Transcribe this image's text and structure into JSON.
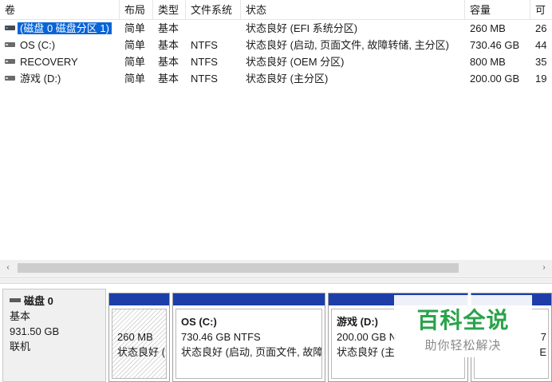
{
  "columns": [
    "卷",
    "布局",
    "类型",
    "文件系统",
    "状态",
    "容量",
    "可"
  ],
  "volumes": [
    {
      "icon": "efi-volume-icon",
      "name": "(磁盘 0 磁盘分区 1)",
      "layout": "简单",
      "type": "基本",
      "fs": "",
      "status": "状态良好 (EFI 系统分区)",
      "capacity": "260 MB",
      "free": "26",
      "selected": true
    },
    {
      "icon": "volume-icon",
      "name": "OS (C:)",
      "layout": "简单",
      "type": "基本",
      "fs": "NTFS",
      "status": "状态良好 (启动, 页面文件, 故障转储, 主分区)",
      "capacity": "730.46 GB",
      "free": "44",
      "selected": false
    },
    {
      "icon": "volume-icon",
      "name": "RECOVERY",
      "layout": "简单",
      "type": "基本",
      "fs": "NTFS",
      "status": "状态良好 (OEM 分区)",
      "capacity": "800 MB",
      "free": "35",
      "selected": false
    },
    {
      "icon": "volume-icon",
      "name": "游戏 (D:)",
      "layout": "简单",
      "type": "基本",
      "fs": "NTFS",
      "status": "状态良好 (主分区)",
      "capacity": "200.00 GB",
      "free": "19",
      "selected": false
    }
  ],
  "scrollbar": {
    "left_arrow": "‹",
    "right_arrow": "›"
  },
  "disk": {
    "title": "磁盘 0",
    "type": "基本",
    "size": "931.50 GB",
    "state": "联机"
  },
  "partitions": [
    {
      "name": "",
      "size": "260 MB",
      "status": "状态良好 (",
      "hatched": true
    },
    {
      "name": "OS  (C:)",
      "size": "730.46 GB NTFS",
      "status": "状态良好 (启动, 页面文件, 故障",
      "hatched": false
    },
    {
      "name": "游戏  (D:)",
      "size": "200.00 GB N",
      "status": "状态良好 (主",
      "hatched": false
    },
    {
      "name": "",
      "size": "7",
      "status": "E",
      "hatched": false
    }
  ],
  "watermark": {
    "title": "百科全说",
    "subtitle": "助你轻松解决"
  },
  "colors": {
    "selection": "#0a64d7",
    "partition_bar": "#1d3ea8",
    "watermark_green": "#2aa34a"
  }
}
